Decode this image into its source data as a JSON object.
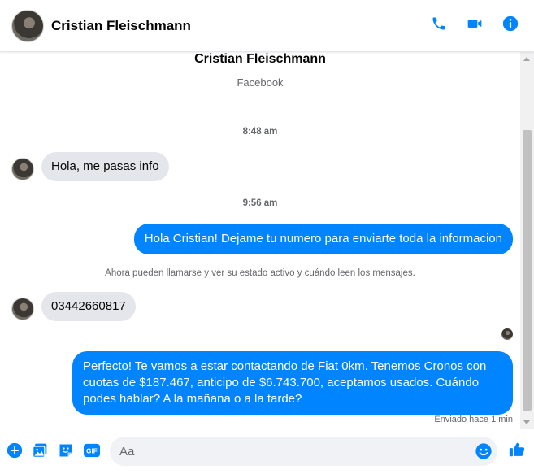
{
  "header": {
    "contact_name": "Cristian Fleischmann"
  },
  "profile": {
    "name": "Cristian Fleischmann",
    "source": "Facebook"
  },
  "thread": {
    "time_1": "8:48 am",
    "incoming_1": "Hola, me pasas info",
    "time_2": "9:56 am",
    "outgoing_1": "Hola Cristian! Dejame tu numero para enviarte toda la informacion",
    "notice": "Ahora pueden llamarse y ver su estado activo y cuándo leen los mensajes.",
    "incoming_2": "03442660817",
    "outgoing_2": "Perfecto! Te vamos a estar contactando de Fiat 0km. Tenemos Cronos con cuotas de $187.467, anticipo de $6.743.700, aceptamos usados. Cuándo podes hablar? A la mañana o a la tarde?",
    "status": "Enviado hace 1 min"
  },
  "composer": {
    "placeholder": "Aa"
  },
  "colors": {
    "accent": "#0084ff",
    "incoming_bubble": "#e4e6eb"
  }
}
